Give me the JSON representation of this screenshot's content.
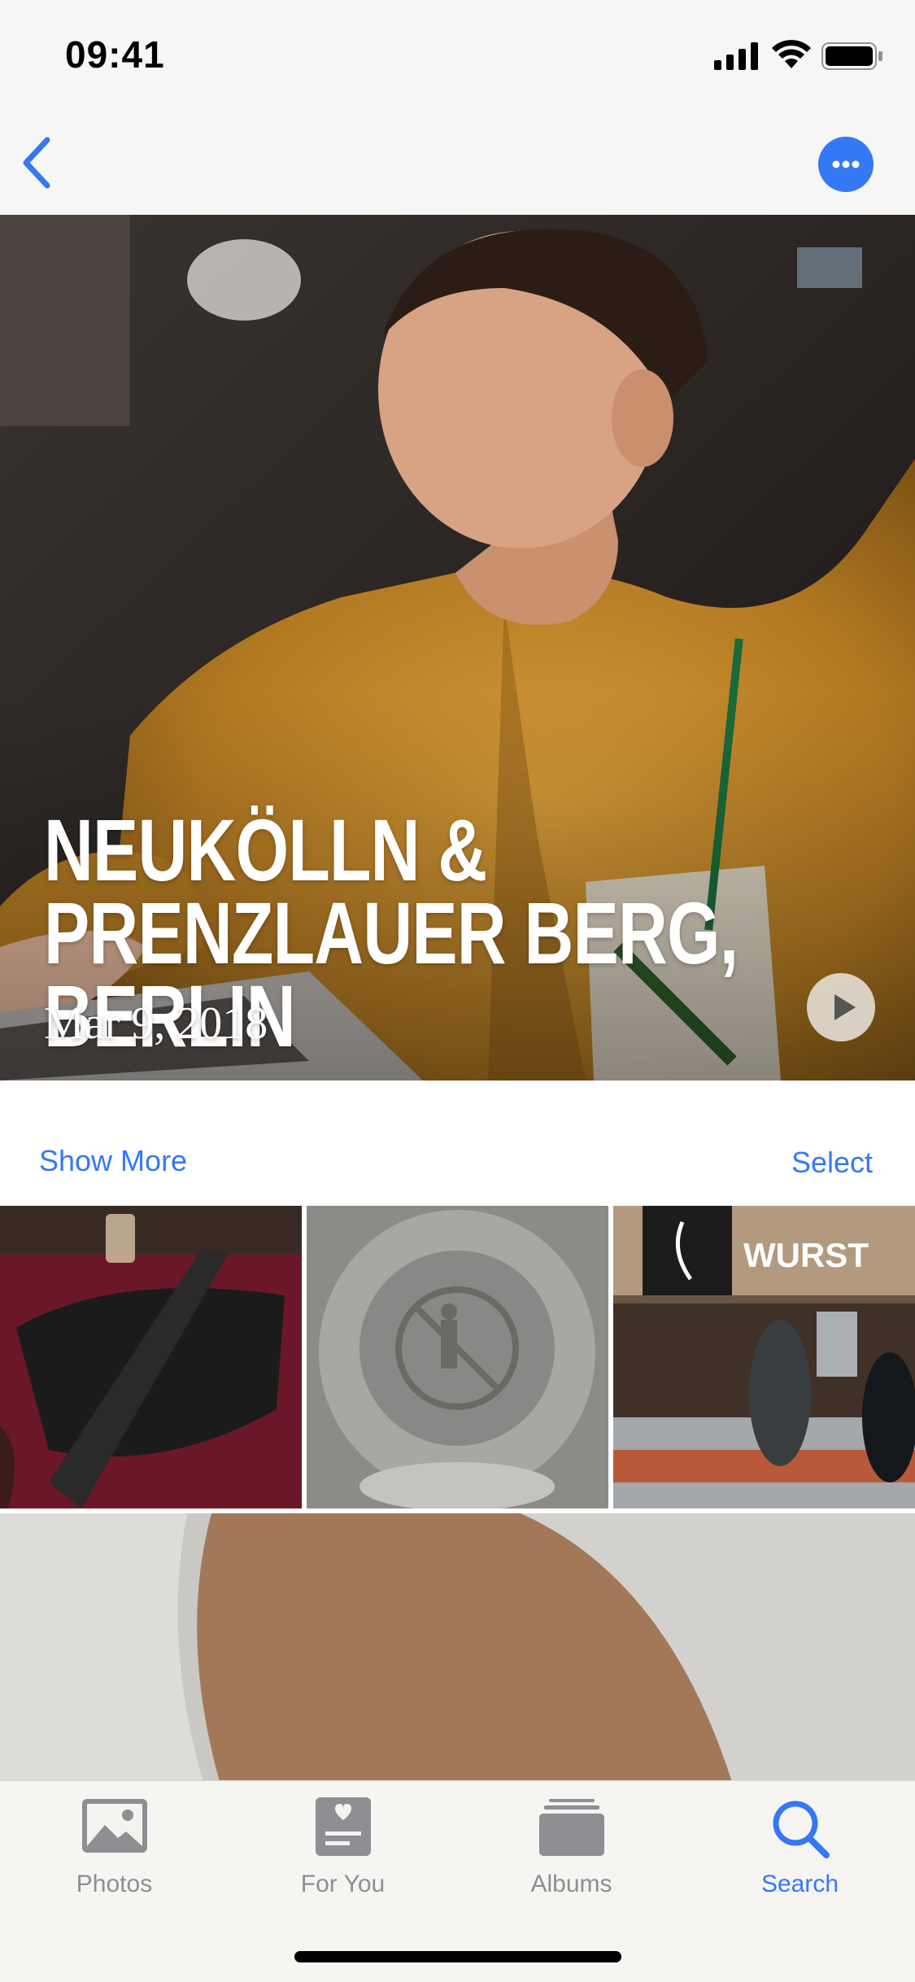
{
  "status_bar": {
    "time": "09:41",
    "icons": [
      "signal-icon",
      "wifi-icon",
      "battery-icon"
    ]
  },
  "nav": {
    "back_icon": "chevron-left-icon",
    "more_icon": "ellipsis-circle-icon",
    "accent_color": "#3478f6"
  },
  "memory": {
    "title": "NEUKÖLLN & PRENZLAUER BERG, BERLIN",
    "date": "Mar 9, 2018",
    "play_icon": "play-icon"
  },
  "actions": {
    "show_more": "Show More",
    "select": "Select"
  },
  "photos": [
    {
      "subject": "black bag on red table"
    },
    {
      "subject": "toilet with sticker"
    },
    {
      "subject": "store counter with sign"
    },
    {
      "subject": "close-up of arm and shirt"
    }
  ],
  "store_sign": "WURST",
  "tab_bar": {
    "active": "Search",
    "tabs": [
      {
        "label": "Photos",
        "icon": "photos-icon"
      },
      {
        "label": "For You",
        "icon": "for-you-icon"
      },
      {
        "label": "Albums",
        "icon": "albums-icon"
      },
      {
        "label": "Search",
        "icon": "search-icon"
      }
    ]
  }
}
